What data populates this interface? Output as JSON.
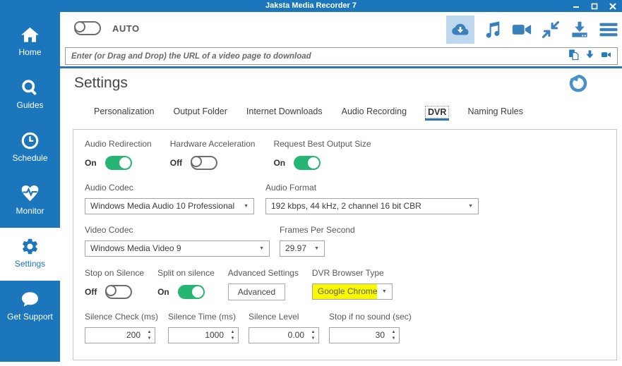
{
  "window": {
    "title": "Jaksta Media Recorder 7"
  },
  "colors": {
    "primary_blue": "#1b76bb",
    "accent_blue": "#2e75b6",
    "icon_blue": "#3a80bd",
    "toggle_green": "#26b573",
    "selected_icon_bg": "#bdd7ee",
    "highlight_yellow": "#f8f800"
  },
  "sidebar": {
    "items": [
      {
        "label": "Home",
        "icon": "home-icon"
      },
      {
        "label": "Guides",
        "icon": "search-icon"
      },
      {
        "label": "Schedule",
        "icon": "clock-icon"
      },
      {
        "label": "Monitor",
        "icon": "heart-pulse-icon"
      },
      {
        "label": "Settings",
        "icon": "gear-icon",
        "selected": true
      },
      {
        "label": "Get Support",
        "icon": "chat-bubble-icon"
      }
    ]
  },
  "toolbar": {
    "auto_label": "AUTO",
    "auto_state": "off",
    "icons": [
      "cloud-download-icon (selected)",
      "music-note-icon",
      "video-camera-icon",
      "collapse-arrows-icon",
      "download-tray-icon",
      "hamburger-menu-icon"
    ]
  },
  "url_bar": {
    "placeholder": "Enter (or Drag and Drop) the URL of a video page to download",
    "icons": [
      "paste-icon",
      "download-arrow-icon",
      "record-camera-icon"
    ]
  },
  "glyphs": {
    "dropdown_caret": "▼",
    "spin_up": "▲",
    "spin_down": "▼"
  },
  "settings": {
    "title": "Settings",
    "tabs": [
      {
        "label": "Personalization"
      },
      {
        "label": "Output Folder"
      },
      {
        "label": "Internet Downloads"
      },
      {
        "label": "Audio Recording"
      },
      {
        "label": "DVR",
        "selected": true
      },
      {
        "label": "Naming Rules"
      }
    ],
    "panel": {
      "audio_redirection": {
        "label": "Audio Redirection",
        "state": "On"
      },
      "hardware_acceleration": {
        "label": "Hardware Acceleration",
        "state": "Off"
      },
      "request_best_output": {
        "label": "Request Best Output Size",
        "state": "On"
      },
      "audio_codec": {
        "label": "Audio Codec",
        "value": "Windows Media Audio 10 Professional"
      },
      "audio_format": {
        "label": "Audio Format",
        "value": "192 kbps, 44 kHz, 2 channel 16 bit CBR"
      },
      "video_codec": {
        "label": "Video Codec",
        "value": "Windows Media Video 9"
      },
      "frames_per_second": {
        "label": "Frames Per Second",
        "value": "29.97"
      },
      "stop_on_silence": {
        "label": "Stop on Silence",
        "state": "Off"
      },
      "split_on_silence": {
        "label": "Split on silence",
        "state": "On"
      },
      "advanced_settings": {
        "label": "Advanced Settings",
        "button_label": "Advanced"
      },
      "dvr_browser_type": {
        "label": "DVR Browser Type",
        "value": "Google Chrome",
        "highlighted": true
      },
      "spinners": [
        {
          "label": "Silence Check (ms)",
          "value": "200"
        },
        {
          "label": "Silence Time (ms)",
          "value": "1000"
        },
        {
          "label": "Silence Level",
          "value": "0.00"
        },
        {
          "label": "Stop if no sound (sec)",
          "value": "30"
        }
      ]
    }
  }
}
